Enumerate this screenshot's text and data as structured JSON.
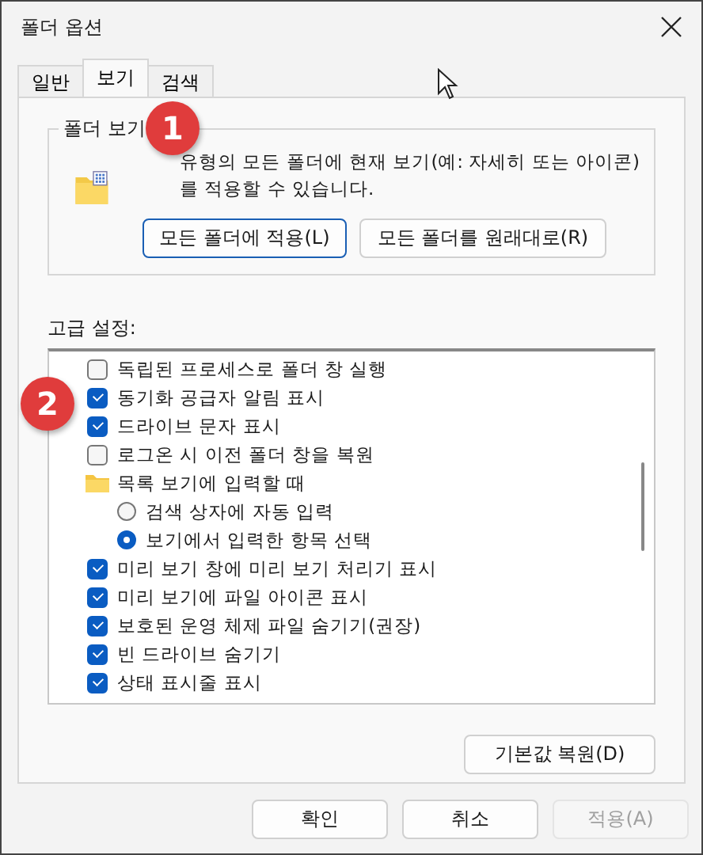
{
  "window": {
    "title": "폴더 옵션"
  },
  "tabs": [
    {
      "label": "일반",
      "selected": false
    },
    {
      "label": "보기",
      "selected": true
    },
    {
      "label": "검색",
      "selected": false
    }
  ],
  "folder_views": {
    "title": "폴더 보기",
    "description": "유형의 모든 폴더에 현재 보기(예: 자세히 또는 아이콘)를 적용할 수 있습니다.",
    "buttons": [
      "모든 폴더에 적용(L)",
      "모든 폴더를 원래대로(R)"
    ]
  },
  "advanced": {
    "title": "고급 설정:",
    "items": [
      {
        "kind": "checkbox",
        "label": "독립된 프로세스로 폴더 창 실행",
        "checked": false
      },
      {
        "kind": "checkbox",
        "label": "동기화 공급자 알림 표시",
        "checked": true
      },
      {
        "kind": "checkbox",
        "label": "드라이브 문자 표시",
        "checked": true
      },
      {
        "kind": "checkbox",
        "label": "로그온 시 이전 폴더 창을 복원",
        "checked": false
      },
      {
        "kind": "folder",
        "label": "목록 보기에 입력할 때",
        "children": [
          {
            "kind": "radio",
            "label": "검색 상자에 자동 입력",
            "selected": false
          },
          {
            "kind": "radio",
            "label": "보기에서 입력한 항목 선택",
            "selected": true
          }
        ]
      },
      {
        "kind": "checkbox",
        "label": "미리 보기 창에 미리 보기 처리기 표시",
        "checked": true
      },
      {
        "kind": "checkbox",
        "label": "미리 보기에 파일 아이콘 표시",
        "checked": true
      },
      {
        "kind": "checkbox",
        "label": "보호된 운영 체제 파일 숨기기(권장)",
        "checked": true
      },
      {
        "kind": "checkbox",
        "label": "빈 드라이브 숨기기",
        "checked": true
      },
      {
        "kind": "checkbox",
        "label": "상태 표시줄 표시",
        "checked": true
      }
    ],
    "restore_button": "기본값 복원(D)"
  },
  "buttons": [
    {
      "label": "확인",
      "disabled": false
    },
    {
      "label": "취소",
      "disabled": false
    },
    {
      "label": "적용(A)",
      "disabled": true
    }
  ],
  "callouts": [
    "1",
    "2"
  ]
}
